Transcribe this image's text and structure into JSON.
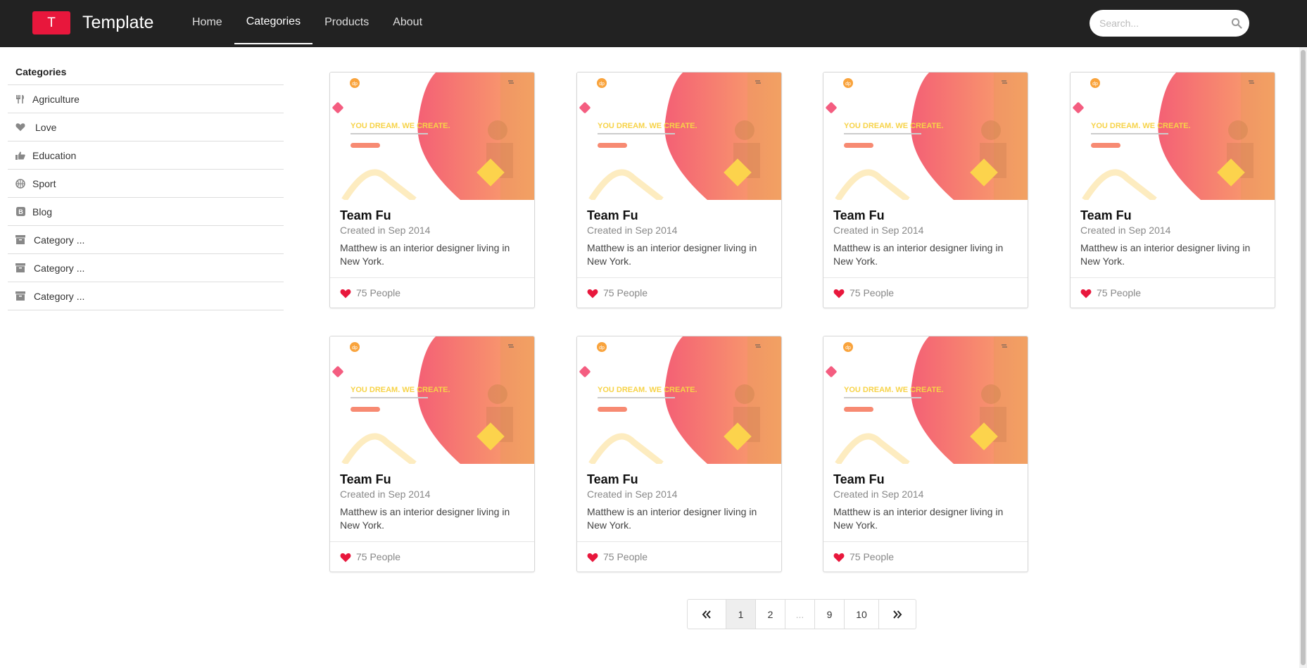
{
  "brand": {
    "logo_letter": "T",
    "name": "Template"
  },
  "nav": {
    "links": [
      "Home",
      "Categories",
      "Products",
      "About"
    ],
    "active": "Categories"
  },
  "search": {
    "placeholder": "Search...",
    "value": ""
  },
  "sidebar": {
    "title": "Categories",
    "items": [
      {
        "label": "Agriculture",
        "icon": "cutlery-icon"
      },
      {
        "label": "Love",
        "icon": "heart-icon"
      },
      {
        "label": "Education",
        "icon": "thumbs-up-icon"
      },
      {
        "label": "Sport",
        "icon": "basketball-icon"
      },
      {
        "label": "Blog",
        "icon": "blog-icon"
      },
      {
        "label": "Category ...",
        "icon": "archive-icon"
      },
      {
        "label": "Category ...",
        "icon": "archive-icon"
      },
      {
        "label": "Category ...",
        "icon": "archive-icon"
      }
    ]
  },
  "cards": [
    {
      "title": "Team Fu",
      "meta": "Created in Sep 2014",
      "description": "Matthew is an interior designer living in New York.",
      "people": "75 People",
      "headline": "YOU DREAM. WE CREATE."
    },
    {
      "title": "Team Fu",
      "meta": "Created in Sep 2014",
      "description": "Matthew is an interior designer living in New York.",
      "people": "75 People",
      "headline": "YOU DREAM. WE CREATE."
    },
    {
      "title": "Team Fu",
      "meta": "Created in Sep 2014",
      "description": "Matthew is an interior designer living in New York.",
      "people": "75 People",
      "headline": "YOU DREAM. WE CREATE."
    },
    {
      "title": "Team Fu",
      "meta": "Created in Sep 2014",
      "description": "Matthew is an interior designer living in New York.",
      "people": "75 People",
      "headline": "YOU DREAM. WE CREATE."
    },
    {
      "title": "Team Fu",
      "meta": "Created in Sep 2014",
      "description": "Matthew is an interior designer living in New York.",
      "people": "75 People",
      "headline": "YOU DREAM. WE CREATE."
    },
    {
      "title": "Team Fu",
      "meta": "Created in Sep 2014",
      "description": "Matthew is an interior designer living in New York.",
      "people": "75 People",
      "headline": "YOU DREAM. WE CREATE."
    },
    {
      "title": "Team Fu",
      "meta": "Created in Sep 2014",
      "description": "Matthew is an interior designer living in New York.",
      "people": "75 People",
      "headline": "YOU DREAM. WE CREATE."
    }
  ],
  "pagination": {
    "first_icon": "double-chevron-left-icon",
    "pages": [
      "1",
      "2",
      "...",
      "9",
      "10"
    ],
    "active": "1",
    "last_icon": "double-chevron-right-icon"
  },
  "colors": {
    "navbar": "#222222",
    "brand_red": "#e8173c",
    "heart": "#e8173c",
    "gradient_pink": "#f4646e",
    "gradient_orange": "#f9a86a",
    "headline_yellow": "#f7d348"
  }
}
